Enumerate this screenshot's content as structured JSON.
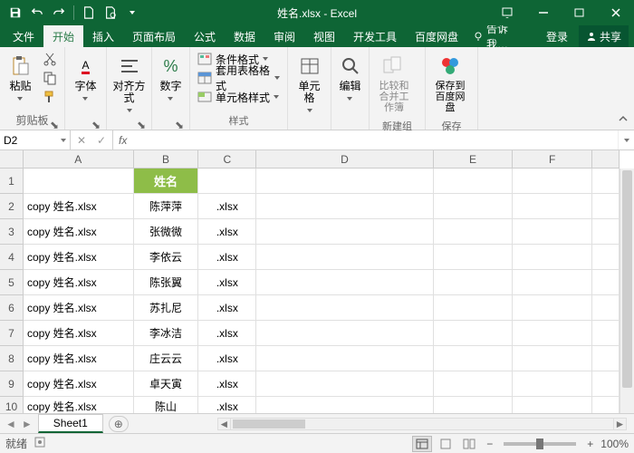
{
  "title": "姓名.xlsx - Excel",
  "tabs": [
    "文件",
    "开始",
    "插入",
    "页面布局",
    "公式",
    "数据",
    "审阅",
    "视图",
    "开发工具",
    "百度网盘"
  ],
  "active_tab": 1,
  "tell_me": "告诉我…",
  "login": "登录",
  "share": "共享",
  "ribbon": {
    "clipboard": {
      "label": "剪贴板",
      "paste": "粘贴"
    },
    "font": {
      "label": "字体"
    },
    "align": {
      "label": "对齐方式"
    },
    "number": {
      "label": "数字"
    },
    "styles": {
      "label": "样式",
      "cond": "条件格式",
      "table": "套用表格格式",
      "cell": "单元格样式"
    },
    "cells": {
      "label": "单元格"
    },
    "editing": {
      "label": "编辑"
    },
    "newgroup": {
      "label": "新建组",
      "compare": "比较和合并工作簿"
    },
    "save": {
      "label": "保存",
      "btn": "保存到百度网盘"
    }
  },
  "namebox": "D2",
  "columns": [
    "A",
    "B",
    "C",
    "D",
    "E",
    "F"
  ],
  "col_header_b": "姓名",
  "rows": [
    {
      "a": "copy 姓名.xlsx",
      "b": "陈萍萍",
      "c": ".xlsx"
    },
    {
      "a": "copy 姓名.xlsx",
      "b": "张微微",
      "c": ".xlsx"
    },
    {
      "a": "copy 姓名.xlsx",
      "b": "李依云",
      "c": ".xlsx"
    },
    {
      "a": "copy 姓名.xlsx",
      "b": "陈张翼",
      "c": ".xlsx"
    },
    {
      "a": "copy 姓名.xlsx",
      "b": "苏扎尼",
      "c": ".xlsx"
    },
    {
      "a": "copy 姓名.xlsx",
      "b": "李冰洁",
      "c": ".xlsx"
    },
    {
      "a": "copy 姓名.xlsx",
      "b": "庄云云",
      "c": ".xlsx"
    },
    {
      "a": "copy 姓名.xlsx",
      "b": "卓天寅",
      "c": ".xlsx"
    },
    {
      "a": "copy 姓名.xlsx",
      "b": "陈山",
      "c": ".xlsx"
    }
  ],
  "sheet": "Sheet1",
  "status": "就绪",
  "zoom": "100%"
}
